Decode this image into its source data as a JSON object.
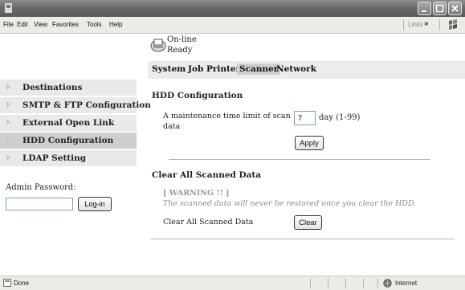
{
  "menu": [
    "File",
    "Edit",
    "View",
    "Favorites",
    "Tools",
    "Help"
  ],
  "links_label": "Links",
  "links_chevron": "»",
  "status": {
    "online": "On-line",
    "ready": "Ready"
  },
  "tabs": [
    {
      "label": "System",
      "active": false
    },
    {
      "label": "Job",
      "active": false
    },
    {
      "label": "Printer",
      "active": false
    },
    {
      "label": "Scanner",
      "active": true
    },
    {
      "label": "Network",
      "active": false
    }
  ],
  "sidebar": {
    "items": [
      {
        "label": "Destinations",
        "active": false
      },
      {
        "label": "SMTP & FTP Configuration",
        "active": false
      },
      {
        "label": "External Open Link",
        "active": false
      },
      {
        "label": "HDD Configuration",
        "active": true
      },
      {
        "label": "LDAP Setting",
        "active": false
      }
    ],
    "admin_password_label": "Admin Password:",
    "login_label": "Log-in"
  },
  "hdd": {
    "heading": "HDD Configuration",
    "maintenance_label": "A maintenance time limit of scan data",
    "days_value": "7",
    "days_unit": "day (1-99)",
    "apply_label": "Apply"
  },
  "clear": {
    "heading": "Clear All Scanned Data",
    "warning_title": "[ WARNING !! ]",
    "warning_text": "The scanned data will never be restored once you clear the HDD.",
    "label": "Clear All Scanned Data",
    "button": "Clear"
  },
  "statusbar": {
    "left": "Done",
    "zone": "Internet"
  },
  "colors": {
    "titlebar": "#6b6b6b",
    "nav_bg": "#e9e9e9",
    "nav_active": "#cfcfcf",
    "warning": "#9a9a9a"
  }
}
